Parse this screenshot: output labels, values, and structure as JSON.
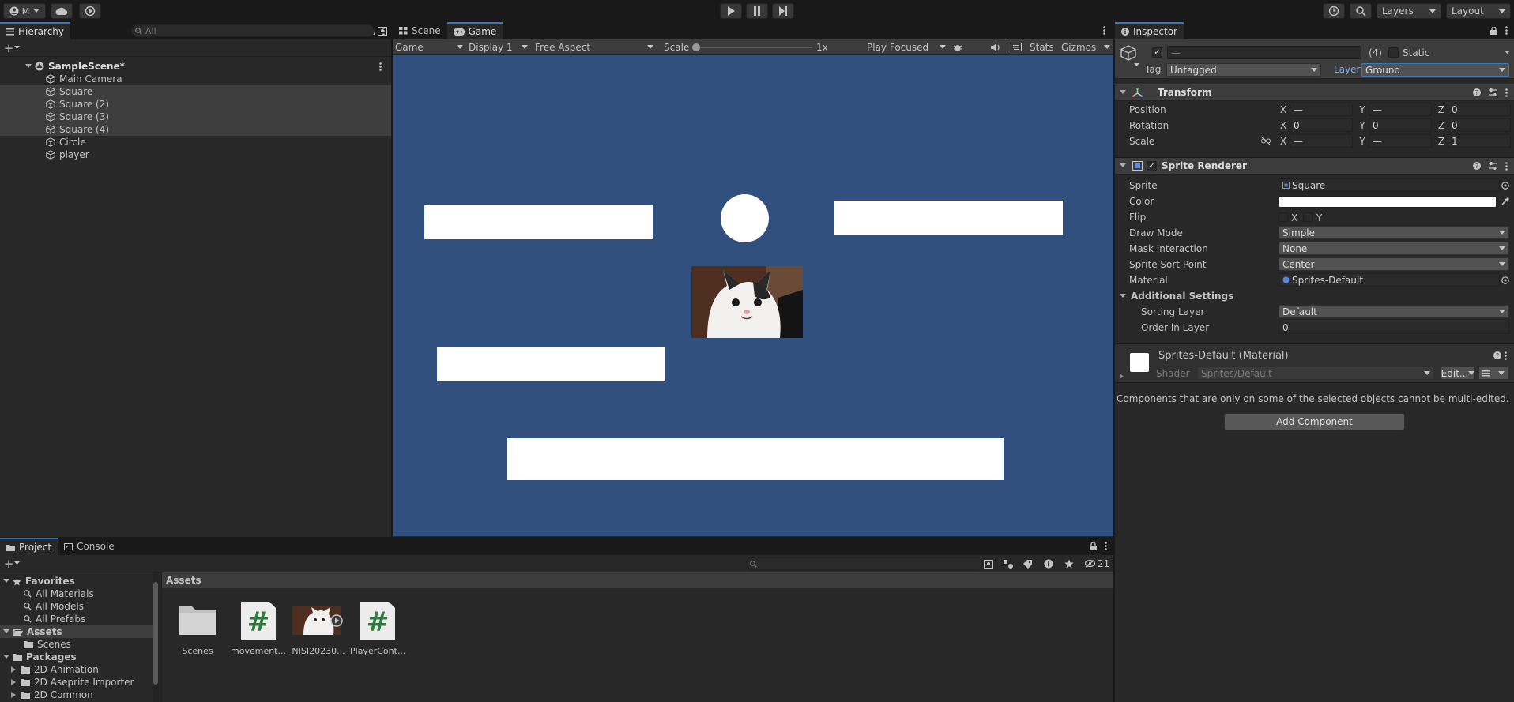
{
  "toolbar": {
    "account_label": "M",
    "layers_label": "Layers",
    "layout_label": "Layout"
  },
  "hierarchy": {
    "tab_label": "Hierarchy",
    "search_placeholder": "All",
    "scene_name": "SampleScene*",
    "items": [
      {
        "label": "Main Camera",
        "selected": false
      },
      {
        "label": "Square",
        "selected": true
      },
      {
        "label": "Square (2)",
        "selected": true
      },
      {
        "label": "Square (3)",
        "selected": true
      },
      {
        "label": "Square (4)",
        "selected": true
      },
      {
        "label": "Circle",
        "selected": false
      },
      {
        "label": "player",
        "selected": false
      }
    ]
  },
  "center": {
    "tabs": [
      {
        "label": "Scene"
      },
      {
        "label": "Game"
      }
    ],
    "game_toolbar": {
      "mode": "Game",
      "display": "Display 1",
      "aspect": "Free Aspect",
      "scale_label": "Scale",
      "scale_value": "1x",
      "play_mode": "Play Focused",
      "stats": "Stats",
      "gizmos": "Gizmos"
    }
  },
  "inspector": {
    "tab_label": "Inspector",
    "name_value": "—",
    "count": "(4)",
    "static_label": "Static",
    "tag_label": "Tag",
    "tag_value": "Untagged",
    "layer_label": "Layer",
    "layer_value": "Ground",
    "transform": {
      "title": "Transform",
      "position_label": "Position",
      "rotation_label": "Rotation",
      "scale_label": "Scale",
      "position": {
        "x": "—",
        "y": "—",
        "z": "0"
      },
      "rotation": {
        "x": "0",
        "y": "0",
        "z": "0"
      },
      "scale": {
        "x": "—",
        "y": "—",
        "z": "1"
      }
    },
    "sprite_renderer": {
      "title": "Sprite Renderer",
      "sprite_label": "Sprite",
      "sprite_value": "Square",
      "color_label": "Color",
      "color_value": "#ffffff",
      "flip_label": "Flip",
      "flip_x": "X",
      "flip_y": "Y",
      "draw_mode_label": "Draw Mode",
      "draw_mode_value": "Simple",
      "mask_label": "Mask Interaction",
      "mask_value": "None",
      "sort_point_label": "Sprite Sort Point",
      "sort_point_value": "Center",
      "material_label": "Material",
      "material_value": "Sprites-Default",
      "additional_label": "Additional Settings",
      "sorting_layer_label": "Sorting Layer",
      "sorting_layer_value": "Default",
      "order_label": "Order in Layer",
      "order_value": "0"
    },
    "material": {
      "title": "Sprites-Default (Material)",
      "shader_label": "Shader",
      "shader_value": "Sprites/Default",
      "edit_label": "Edit..."
    },
    "multi_edit_note": "Components that are only on some of the selected objects cannot be multi-edited.",
    "add_component_label": "Add Component"
  },
  "project": {
    "tabs": [
      {
        "label": "Project"
      },
      {
        "label": "Console"
      }
    ],
    "hidden_count": "21",
    "breadcrumb": "Assets",
    "favorites_label": "Favorites",
    "favorites": [
      "All Materials",
      "All Models",
      "All Prefabs"
    ],
    "assets_label": "Assets",
    "assets_children": [
      "Scenes"
    ],
    "packages_label": "Packages",
    "packages": [
      "2D Animation",
      "2D Aseprite Importer",
      "2D Common"
    ],
    "assets": [
      {
        "label": "Scenes",
        "kind": "folder"
      },
      {
        "label": "movement...",
        "kind": "script"
      },
      {
        "label": "NISI20230...",
        "kind": "video"
      },
      {
        "label": "PlayerCont...",
        "kind": "script"
      }
    ]
  },
  "colors": {
    "game_bg": "#31507e",
    "accent": "#3a79bb",
    "panel": "#282828"
  }
}
